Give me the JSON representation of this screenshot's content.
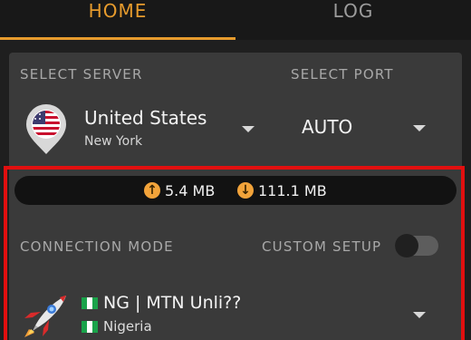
{
  "tabs": {
    "home": "HOME",
    "log": "LOG"
  },
  "server": {
    "section_label": "SELECT SERVER",
    "country": "United States",
    "city": "New York",
    "flag_icon": "us-flag-pin-icon"
  },
  "port": {
    "section_label": "SELECT PORT",
    "value": "AUTO"
  },
  "usage": {
    "upload": "5.4 MB",
    "download": "111.1 MB",
    "upload_icon": "arrow-up-circle-icon",
    "download_icon": "arrow-down-circle-icon"
  },
  "connection": {
    "mode_label": "CONNECTION MODE",
    "custom_setup_label": "CUSTOM SETUP",
    "custom_setup_enabled": false
  },
  "config": {
    "name": "NG | MTN Unli??",
    "country": "Nigeria",
    "icon": "rocket-icon"
  },
  "colors": {
    "accent": "#e69b2d",
    "highlight": "#e20f0f",
    "card": "#3a3a3a"
  }
}
